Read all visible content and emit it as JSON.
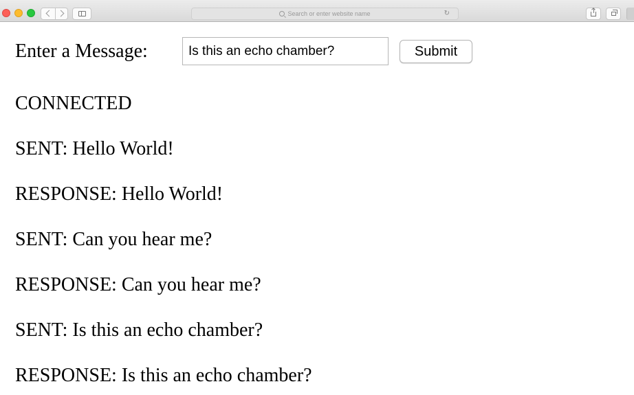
{
  "browser": {
    "address_placeholder": "Search or enter website name"
  },
  "form": {
    "label": "Enter a Message:",
    "input_value": "Is this an echo chamber?",
    "submit_label": "Submit"
  },
  "messages": [
    "CONNECTED",
    "SENT: Hello World!",
    "RESPONSE: Hello World!",
    "SENT: Can you hear me?",
    "RESPONSE: Can you hear me?",
    "SENT: Is this an echo chamber?",
    "RESPONSE: Is this an echo chamber?"
  ]
}
